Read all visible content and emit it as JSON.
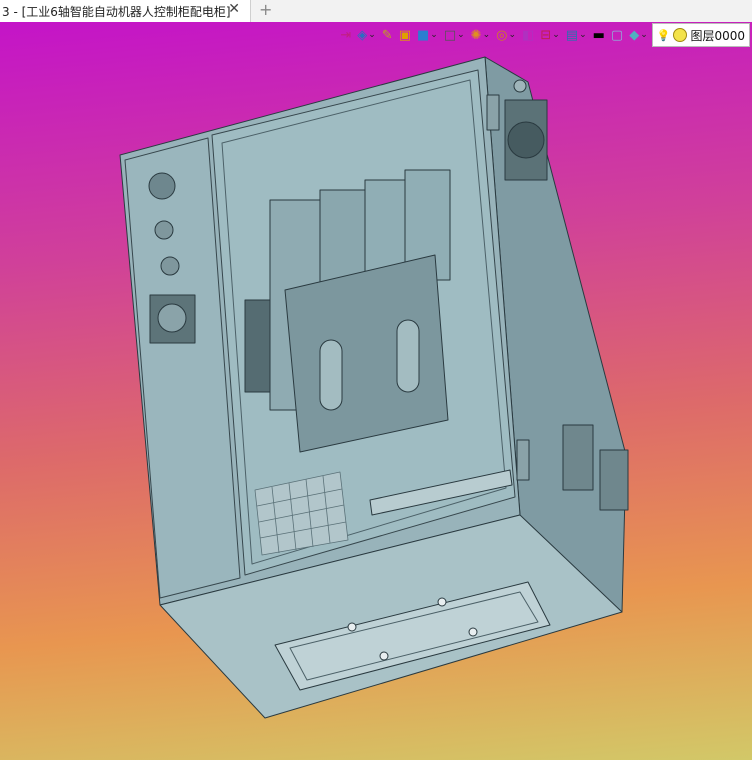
{
  "tab": {
    "title": "3 - [工业6轴智能自动机器人控制柜配电柜]",
    "close": "✕",
    "new_tab": "+"
  },
  "toolbar": {
    "items": [
      {
        "name": "exit-sketch-icon",
        "glyph": "⇥",
        "color": "#c02080",
        "dropdown": false
      },
      {
        "name": "view-orientation-icon",
        "glyph": "◈",
        "color": "#2a6fc0",
        "dropdown": true
      },
      {
        "name": "pencil-icon",
        "glyph": "✎",
        "color": "#c0a020",
        "dropdown": false
      },
      {
        "name": "cube-assembly-icon",
        "glyph": "▣",
        "color": "#e0a000",
        "dropdown": false
      },
      {
        "name": "cube-shaded-icon",
        "glyph": "■",
        "color": "#2a7fd0",
        "dropdown": true
      },
      {
        "name": "cube-wireframe-icon",
        "glyph": "□",
        "color": "#555555",
        "dropdown": true
      },
      {
        "name": "appearance-icon",
        "glyph": "✺",
        "color": "#e09020",
        "dropdown": true
      },
      {
        "name": "zoom-icon",
        "glyph": "◎",
        "color": "#d08020",
        "dropdown": true
      },
      {
        "name": "section-view-icon",
        "glyph": "◧",
        "color": "#b030c0",
        "dropdown": false
      },
      {
        "name": "hide-show-icon",
        "glyph": "⊟",
        "color": "#c02050",
        "dropdown": true
      },
      {
        "name": "display-pane-icon",
        "glyph": "▤",
        "color": "#2a70b0",
        "dropdown": true
      },
      {
        "name": "color-black-icon",
        "glyph": "▬",
        "color": "#000000",
        "dropdown": false
      },
      {
        "name": "background-color-icon",
        "glyph": "▢",
        "color": "#8fb0d8",
        "dropdown": false
      },
      {
        "name": "layer-icon",
        "glyph": "◆",
        "color": "#4fb0c0",
        "dropdown": true
      }
    ],
    "layer_label": "图层0000",
    "accent": "#c414c8"
  }
}
